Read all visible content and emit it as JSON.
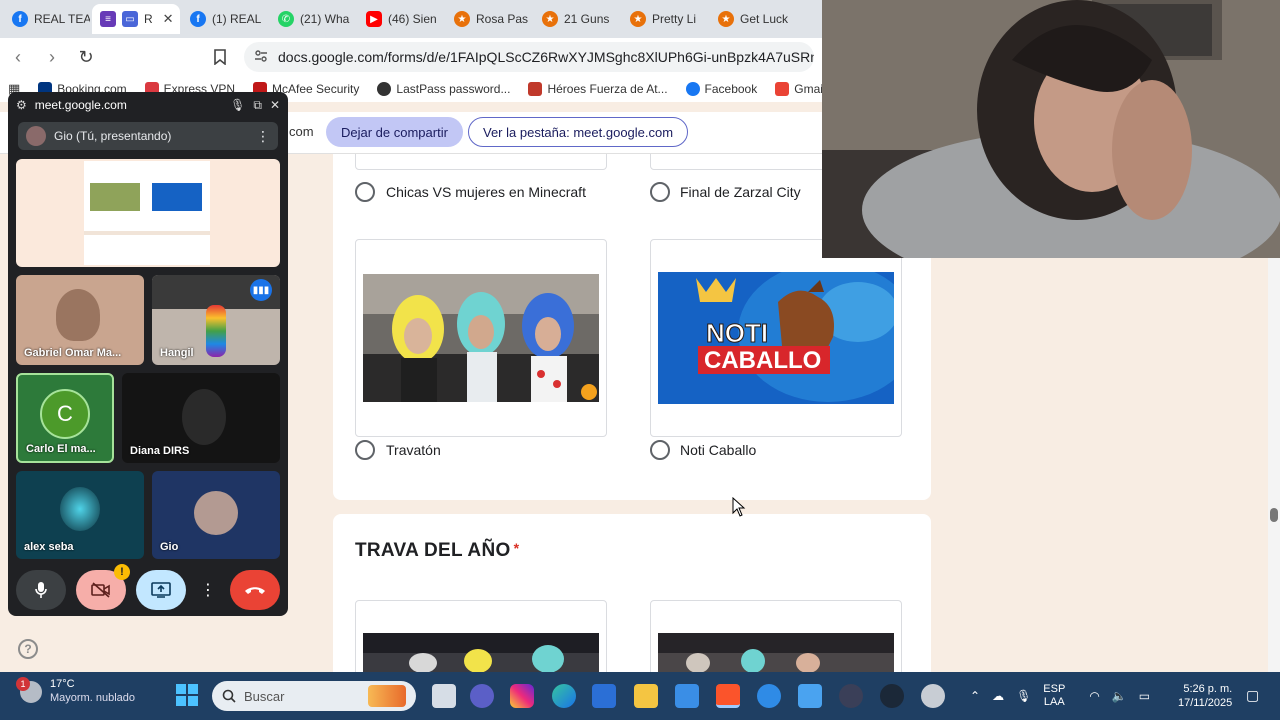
{
  "browser": {
    "tabs": [
      {
        "label": "REAL TEA",
        "icon": "facebook-icon",
        "color": "#1877f2",
        "active": false
      },
      {
        "label": "R",
        "icon": "forms-icon",
        "color": "#673ab7",
        "active": true
      },
      {
        "label": "(1) REAL",
        "icon": "facebook-icon",
        "color": "#1877f2",
        "active": false
      },
      {
        "label": "(21) Wha",
        "icon": "whatsapp-icon",
        "color": "#25d366",
        "active": false
      },
      {
        "label": "(46) Sien",
        "icon": "youtube-icon",
        "color": "#ff0000",
        "active": false
      },
      {
        "label": "Rosa Pas",
        "icon": "shield-icon",
        "color": "#e8710a",
        "active": false
      },
      {
        "label": "21 Guns",
        "icon": "shield-icon",
        "color": "#e8710a",
        "active": false
      },
      {
        "label": "Pretty Li",
        "icon": "shield-icon",
        "color": "#e8710a",
        "active": false
      },
      {
        "label": "Get Luck",
        "icon": "shield-icon",
        "color": "#e8710a",
        "active": false
      }
    ],
    "url": "docs.google.com/forms/d/e/1FAIpQLScCZ6RwXYJMSghc8XlUPh6Gi-unBpzk4A7uSRnohDNJTFic",
    "bookmarks": [
      {
        "label": "Booking.com",
        "color": "#003580"
      },
      {
        "label": "Express VPN",
        "color": "#da3940"
      },
      {
        "label": "McAfee Security",
        "color": "#c01818"
      },
      {
        "label": "LastPass password...",
        "color": "#333333"
      },
      {
        "label": "Héroes Fuerza de At...",
        "color": "#c0392b"
      },
      {
        "label": "Facebook",
        "color": "#1877f2"
      },
      {
        "label": "Gmail",
        "color": "#ea4335"
      }
    ]
  },
  "meet": {
    "pip_title": "meet.google.com",
    "presenter_label": "Gio (Tú, presentando)",
    "share_tail": "com",
    "stop_share": "Dejar de compartir",
    "view_tab": "Ver la pestaña: meet.google.com",
    "participants": [
      {
        "name": "Gabriel Omar Ma..."
      },
      {
        "name": "Hangil"
      },
      {
        "name": "Carlo El ma...",
        "initial": "C"
      },
      {
        "name": "Diana DIRS"
      },
      {
        "name": "alex seba"
      },
      {
        "name": "Gio"
      }
    ],
    "warning_badge": "!"
  },
  "form": {
    "options_top": [
      {
        "label": "Chicas VS mujeres en Minecraft"
      },
      {
        "label": "Final de Zarzal City"
      }
    ],
    "options_mid": [
      {
        "label": "Travatón"
      },
      {
        "label": "Noti Caballo"
      }
    ],
    "noti_caballo_thumb": {
      "line1": "NOTI",
      "line2": "CABALLO"
    },
    "question_title": "TRAVA DEL AÑO",
    "required_mark": "*"
  },
  "taskbar": {
    "weather_badge": "1",
    "temperature": "17°C",
    "weather_desc": "Mayorm. nublado",
    "search_placeholder": "Buscar",
    "lang_1": "ESP",
    "lang_2": "LAA",
    "time": "5:26 p. m.",
    "date": "17/11/2025"
  },
  "help_glyph": "?",
  "colors": {
    "form_bg": "#f8ede3",
    "accent_purple": "#673ab7",
    "taskbar": "#1f3f63",
    "end_call": "#ea4335"
  }
}
